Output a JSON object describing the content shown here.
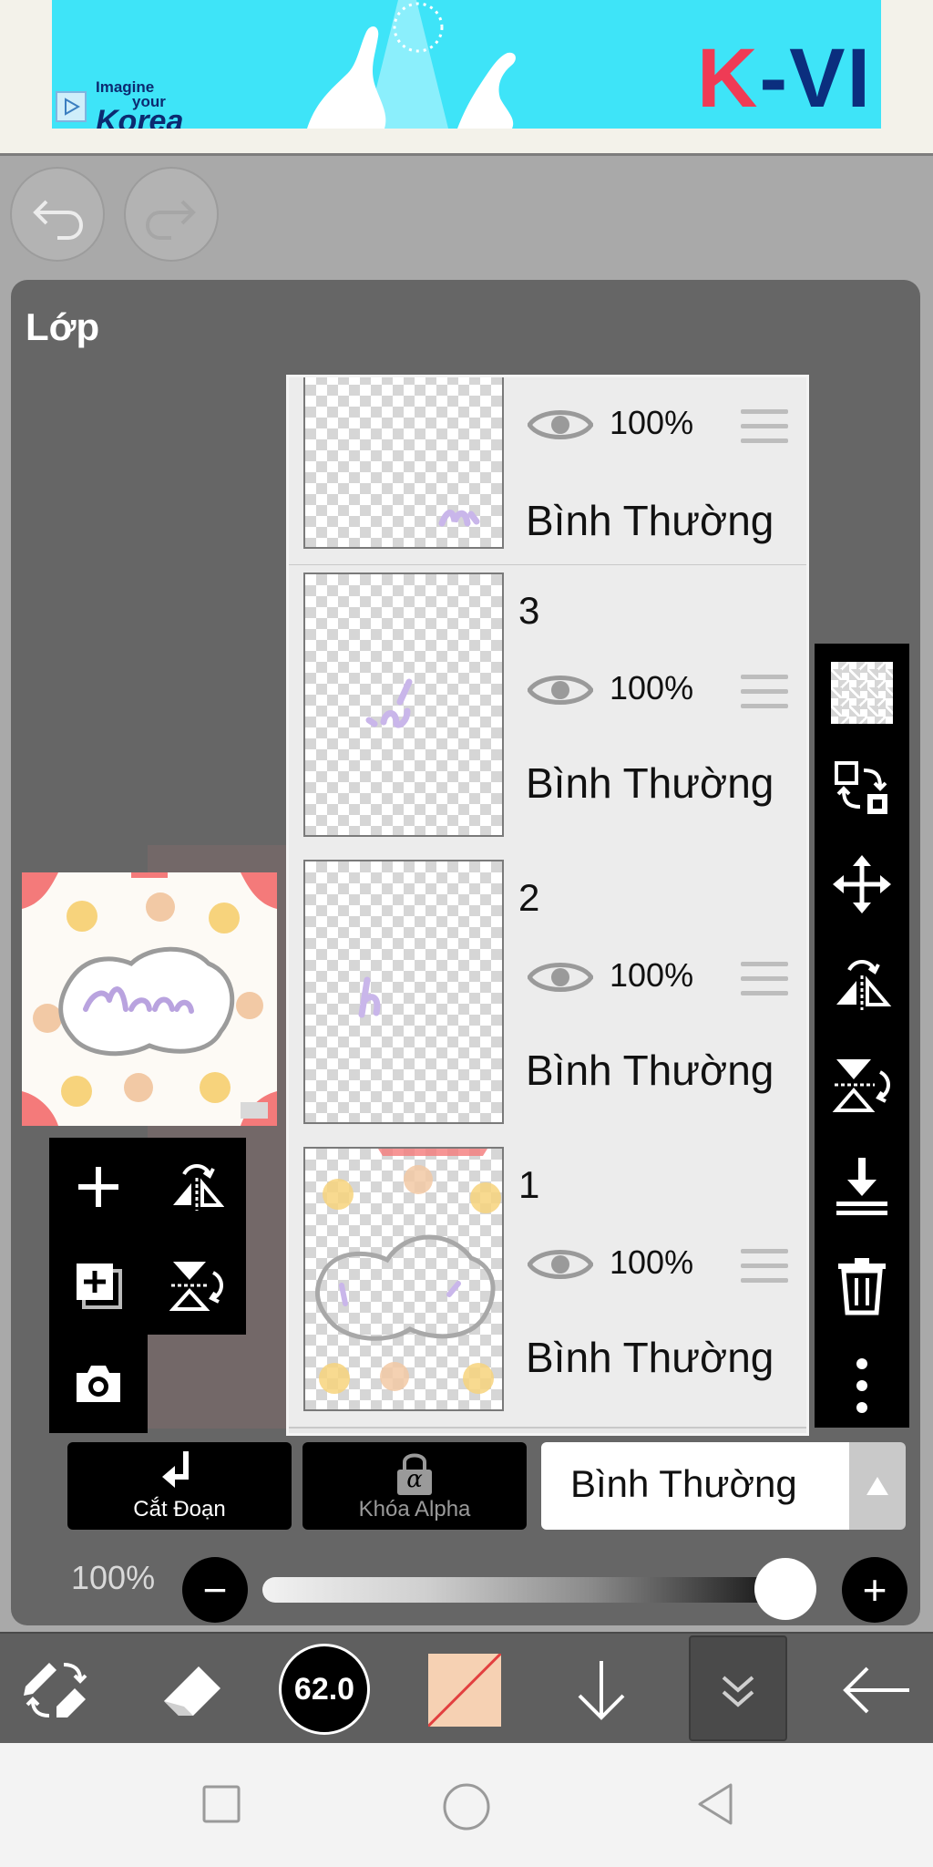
{
  "ad": {
    "line1": "Imagine",
    "line2": "your",
    "line3": "Korea",
    "brand_part1": "K",
    "brand_part2": "-VI"
  },
  "panel": {
    "title": "Lớp"
  },
  "layers": [
    {
      "name": "",
      "opacity": "100%",
      "blend": "Bình Thường"
    },
    {
      "name": "3",
      "opacity": "100%",
      "blend": "Bình Thường"
    },
    {
      "name": "2",
      "opacity": "100%",
      "blend": "Bình Thường"
    },
    {
      "name": "1",
      "opacity": "100%",
      "blend": "Bình Thường"
    }
  ],
  "actions": {
    "clipping_label": "Cắt Đoạn",
    "alpha_lock_label": "Khóa Alpha",
    "blend_mode_value": "Bình Thường",
    "alpha_symbol": "α"
  },
  "opacity": {
    "label": "100%",
    "level": 1.0
  },
  "toolbar": {
    "brush_size": "62.0",
    "color": "#f6d1b3"
  },
  "colors": {
    "panel_bg": "#666666",
    "ad_bg": "#3ee4f8",
    "ad_brand_red": "#ef3b55",
    "ad_brand_blue": "#0b2e7e"
  }
}
